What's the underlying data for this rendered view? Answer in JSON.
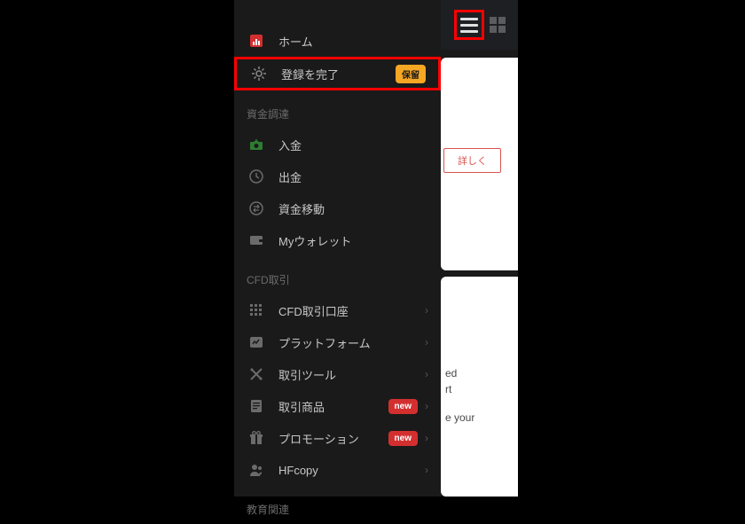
{
  "topbar": {
    "hamburger": "menu",
    "grid": "grid-view"
  },
  "background": {
    "details_button": "詳しく",
    "card2_line1": "ed",
    "card2_line2": "rt",
    "card2_line3": "e your"
  },
  "sidebar": {
    "home": "ホーム",
    "register": "登録を完了",
    "register_badge": "保留",
    "section_funds": "資金調達",
    "deposit": "入金",
    "withdraw": "出金",
    "transfer": "資金移動",
    "wallet": "Myウォレット",
    "section_cfd": "CFD取引",
    "cfd_account": "CFD取引口座",
    "platform": "プラットフォーム",
    "tools": "取引ツール",
    "products": "取引商品",
    "promotion": "プロモーション",
    "hfcopy": "HFcopy",
    "section_edu": "教育関連",
    "new_badge": "new"
  }
}
